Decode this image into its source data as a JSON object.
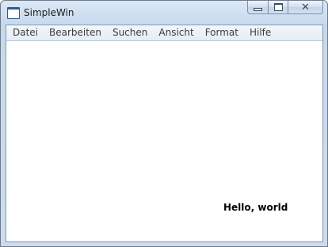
{
  "window": {
    "title": "SimpleWin",
    "icon": "window-app-icon",
    "caption_buttons": {
      "minimize": "minimize-icon",
      "maximize": "maximize-icon",
      "close": "close-icon",
      "close_glyph": "✕"
    }
  },
  "menubar": {
    "items": [
      {
        "label": "Datei"
      },
      {
        "label": "Bearbeiten"
      },
      {
        "label": "Suchen"
      },
      {
        "label": "Ansicht"
      },
      {
        "label": "Format"
      },
      {
        "label": "Hilfe"
      }
    ]
  },
  "content": {
    "text": "Hello, world"
  },
  "colors": {
    "frame": "#c7d9ee",
    "border": "#6d7b8d",
    "client_bg": "#ffffff"
  }
}
